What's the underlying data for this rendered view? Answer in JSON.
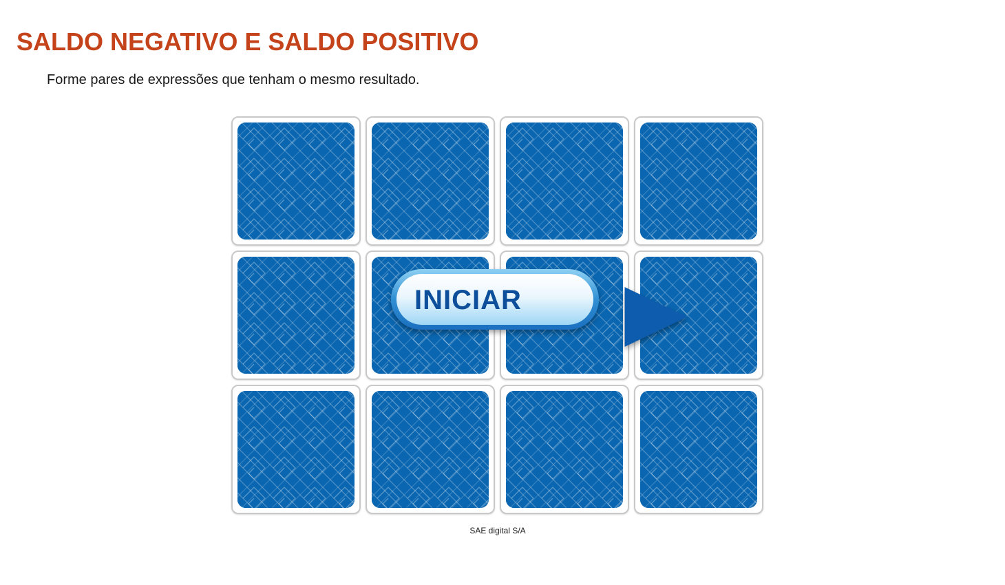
{
  "header": {
    "title": "SALDO NEGATIVO E SALDO POSITIVO",
    "instruction": "Forme pares de expressões que tenham o mesmo resultado."
  },
  "game": {
    "rows": 3,
    "columns": 4,
    "cards": [
      {
        "state": "face-down"
      },
      {
        "state": "face-down"
      },
      {
        "state": "face-down"
      },
      {
        "state": "face-down"
      },
      {
        "state": "face-down"
      },
      {
        "state": "face-down"
      },
      {
        "state": "face-down"
      },
      {
        "state": "face-down"
      },
      {
        "state": "face-down"
      },
      {
        "state": "face-down"
      },
      {
        "state": "face-down"
      },
      {
        "state": "face-down"
      }
    ],
    "start_label": "INICIAR",
    "start_icon": "play-icon"
  },
  "footer": {
    "credit": "SAE digital S/A"
  },
  "colors": {
    "title": "#c4431a",
    "card_back": "#0a66b0",
    "button_text": "#0d4f9a"
  }
}
